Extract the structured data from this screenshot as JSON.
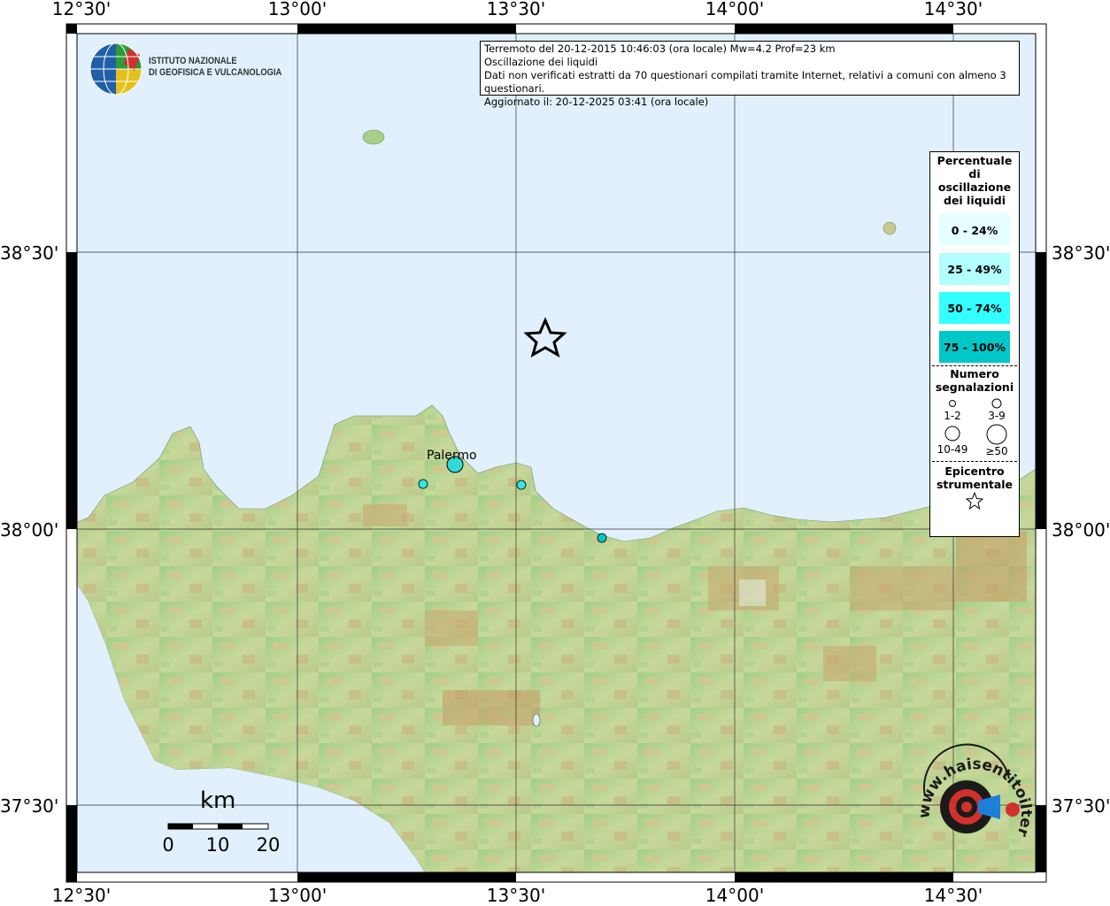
{
  "ingv": {
    "line1": "ISTITUTO NAZIONALE",
    "line2": "DI GEOFISICA E VULCANOLOGIA"
  },
  "info": {
    "line1": "Terremoto del 20-12-2015 10:46:03 (ora locale) Mw=4.2 Prof=23 km",
    "line2": "Oscillazione dei liquidi",
    "line3": "Dati non verificati estratti da 70 questionari compilati tramite Internet, relativi a comuni con almeno 3 questionari.",
    "line4": "Aggiornato il: 20-12-2025 03:41 (ora locale)"
  },
  "axes": {
    "lon_top": [
      "12°30'",
      "13°00'",
      "13°30'",
      "14°00'",
      "14°30'"
    ],
    "lon_bottom": [
      "12°30'",
      "13°00'",
      "13°30'",
      "14°00'",
      "14°30'"
    ],
    "lat_left": [
      "38°30'",
      "38°00'",
      "37°30'"
    ],
    "lat_right": [
      "38°30'",
      "38°00'",
      "37°30'"
    ]
  },
  "legend": {
    "title": "Percentuale di oscillazione dei liquidi",
    "classes": [
      {
        "label": "0 - 24%",
        "color": "#e6ffff"
      },
      {
        "label": "25 - 49%",
        "color": "#b3ffff"
      },
      {
        "label": "50 - 74%",
        "color": "#33ffff"
      },
      {
        "label": "75 - 100%",
        "color": "#00c8c8"
      }
    ],
    "count_title": "Numero segnalazioni",
    "counts": [
      "1-2",
      "3-9",
      "10-49",
      "≥50"
    ],
    "epicenter_title": "Epicentro strumentale"
  },
  "places": {
    "palermo": "Palermo"
  },
  "scale": {
    "unit": "km",
    "ticks": [
      "0",
      "10",
      "20"
    ]
  },
  "colors": {
    "sea": "#e1f0fc",
    "station": "#33e6e6",
    "station_dark": "#00b4b4"
  },
  "watermark": {
    "text": "www.haisentitoilterremoto.it"
  }
}
